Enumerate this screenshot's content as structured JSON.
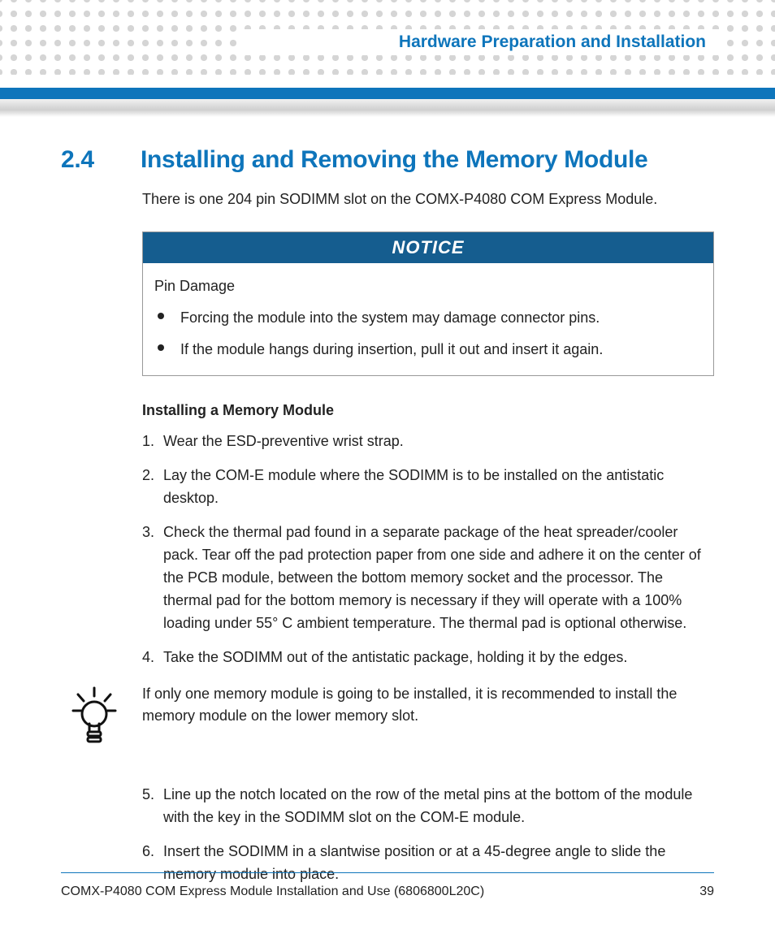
{
  "header": {
    "chapter_title": "Hardware Preparation and Installation"
  },
  "section": {
    "number": "2.4",
    "title": "Installing and Removing the Memory Module",
    "intro": "There is one 204 pin SODIMM slot on the COMX-P4080 COM Express Module."
  },
  "notice": {
    "label": "NOTICE",
    "subtitle": "Pin Damage",
    "bullets": [
      "Forcing the module into the system may damage connector pins.",
      "If the module hangs during insertion, pull it out and insert it again."
    ]
  },
  "procedure": {
    "heading": "Installing a Memory Module",
    "steps_a": [
      "Wear the ESD-preventive wrist strap.",
      "Lay the COM-E module where the SODIMM is to be installed on the antistatic desktop.",
      "Check the thermal pad found in a separate package of the heat spreader/cooler pack. Tear off the pad protection paper from one side and adhere it on the center of the PCB module, between the bottom memory socket and the processor. The thermal pad for the bottom memory is necessary if they will operate with a 100% loading under 55° C ambient temperature. The thermal pad is optional otherwise.",
      "Take the SODIMM out of the antistatic package, holding it by the edges."
    ],
    "tip": "If only one memory module is going to be installed, it is recommended to install the memory module on the lower memory slot.",
    "steps_b": [
      "Line up the notch located on the row of the metal pins at the bottom of the module with the key in the SODIMM slot on the COM-E module.",
      "Insert the SODIMM in a slantwise position or at a 45-degree angle to slide the memory module into place."
    ]
  },
  "footer": {
    "doc": "COMX-P4080 COM Express Module Installation and Use (6806800L20C)",
    "page": "39"
  }
}
